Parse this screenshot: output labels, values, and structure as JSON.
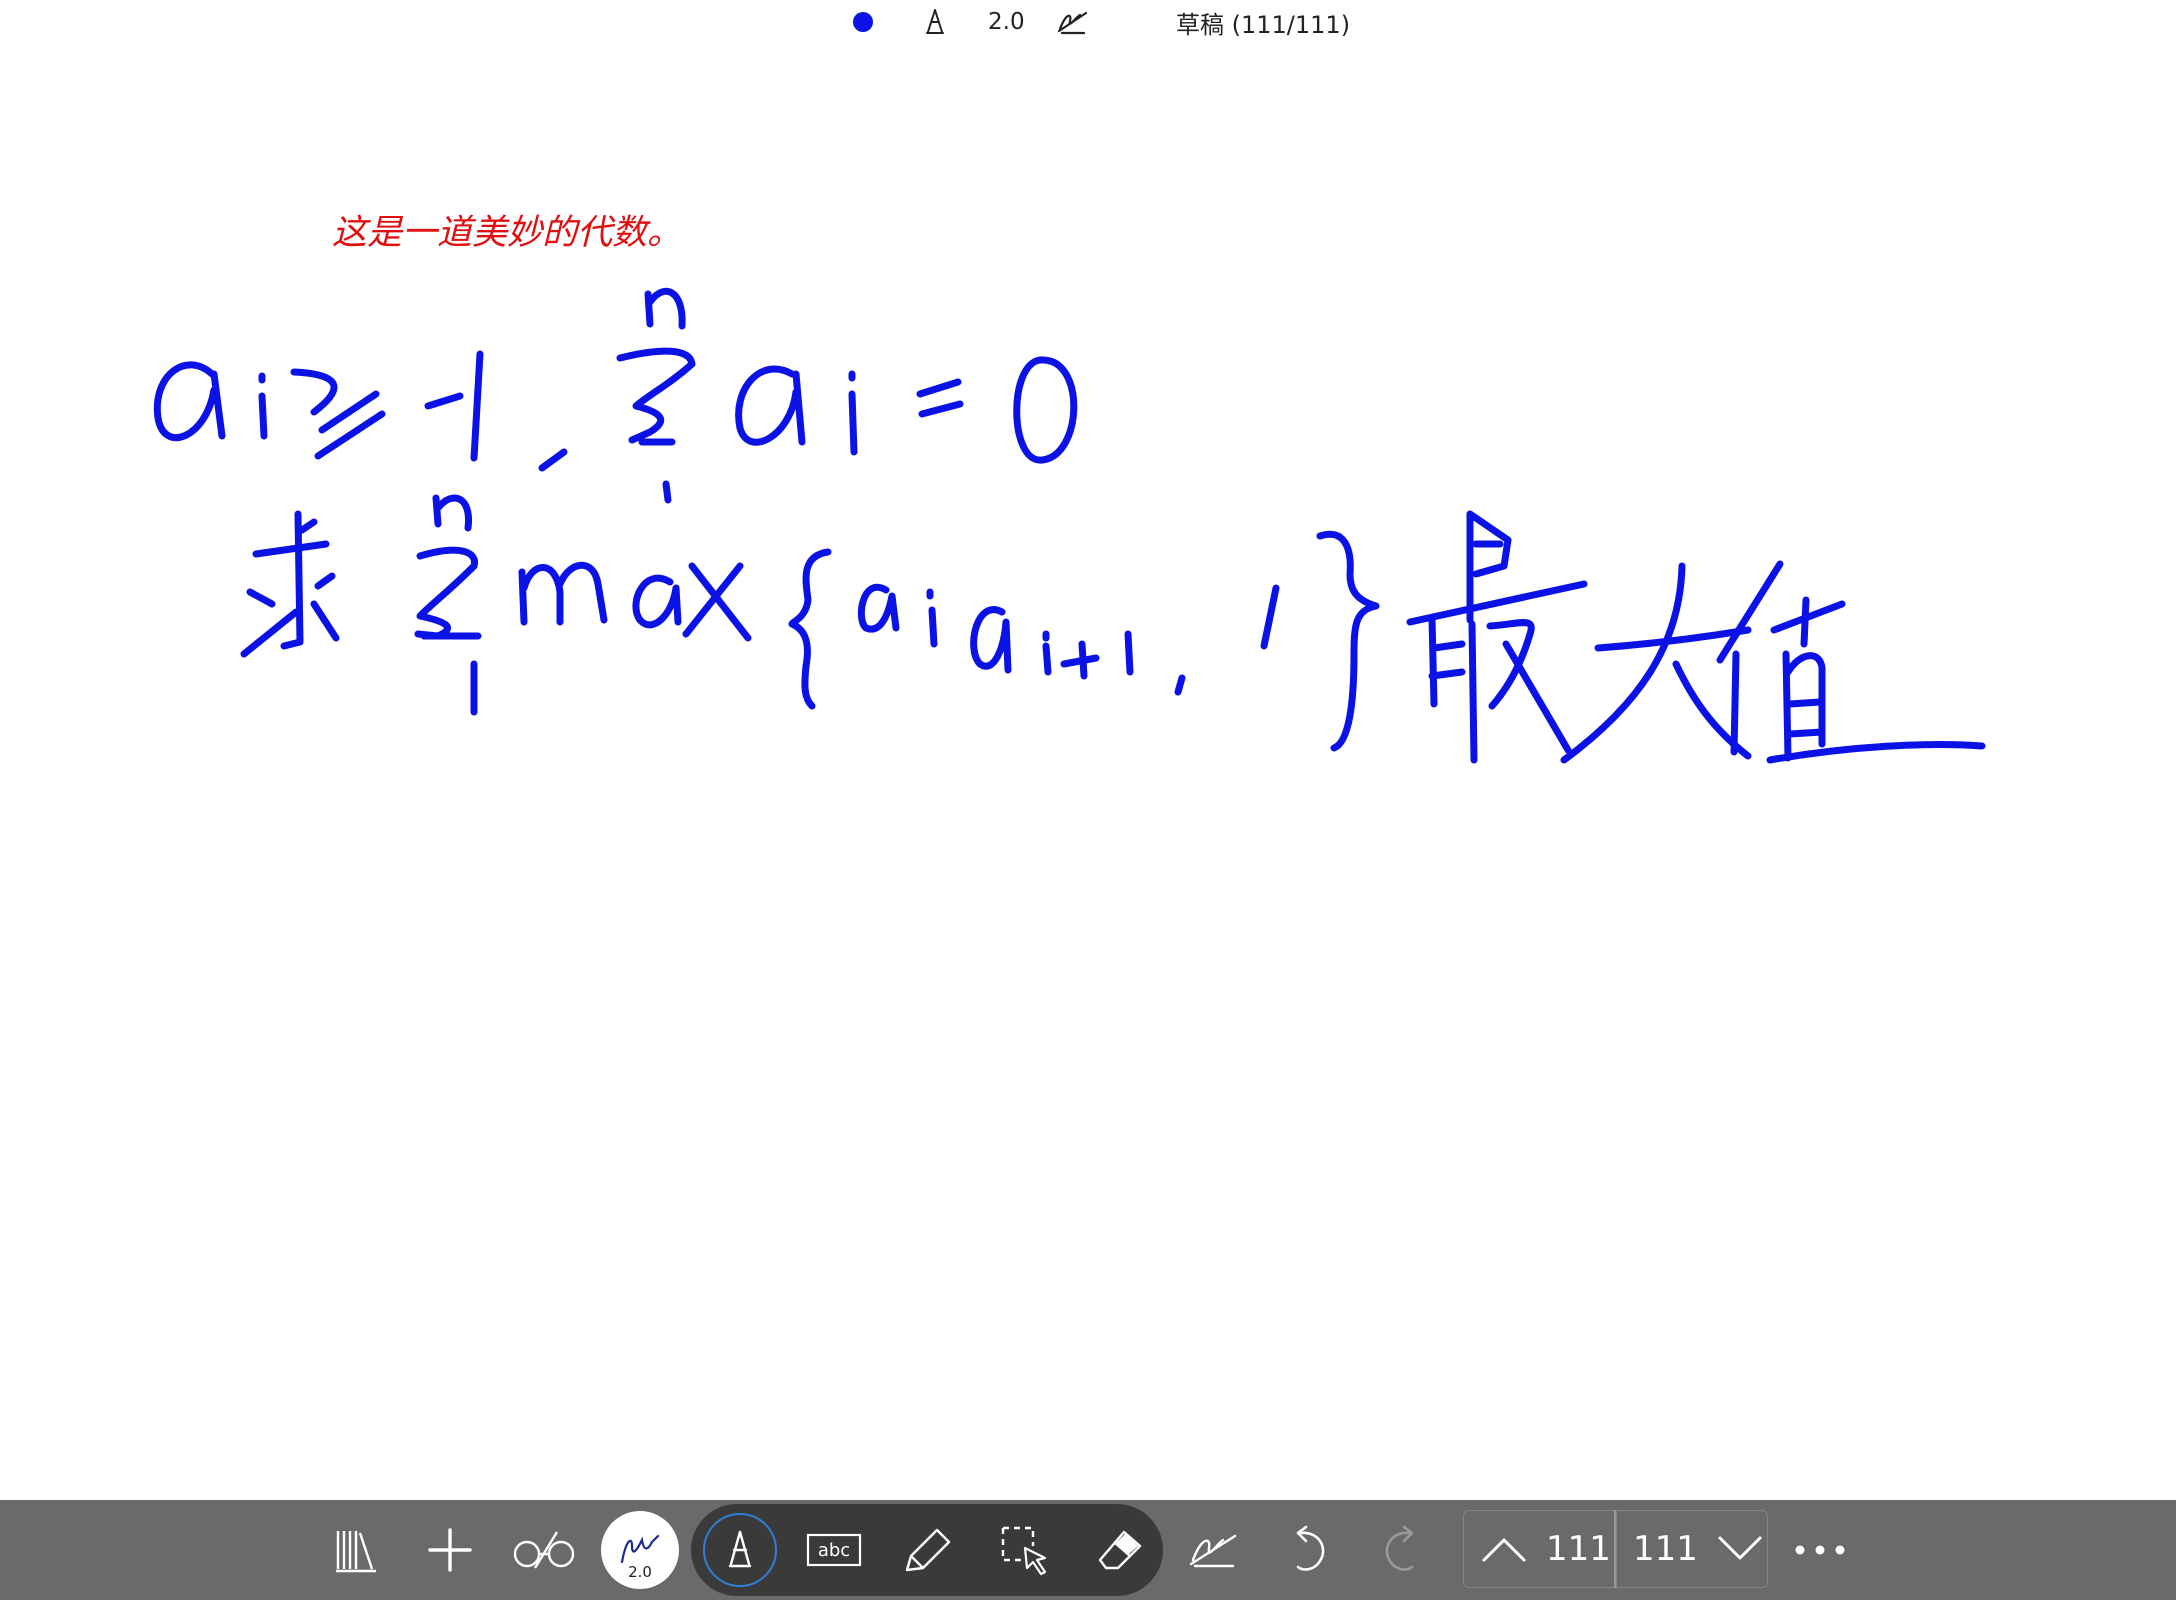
{
  "colors": {
    "ink": "#0a12e6",
    "note_text": "#e01010",
    "toolbar_bg": "#6a6a6a",
    "mode_pill_bg": "#3a3a3a",
    "active_ring": "#2f7fd9"
  },
  "status_bar": {
    "pen_color_icon": "filled-dot-icon",
    "pen_tip_icon": "pen-tip-icon",
    "pen_width": "2.0",
    "handwriting_off_icon": "hand-off-icon",
    "title": "草稿 (111/111)"
  },
  "canvas": {
    "note_text": "这是一道美妙的代数。",
    "handwriting": {
      "line1": [
        "a",
        "i",
        "≥",
        "-1",
        ",",
        "Σ",
        "n",
        "1",
        "a",
        "i",
        "=",
        "0"
      ],
      "line2": [
        "求",
        "Σ",
        "n",
        "1",
        "max",
        "{",
        "a",
        "i",
        "a",
        "i+1",
        ",",
        "1",
        "}",
        "最",
        "大",
        "值"
      ]
    }
  },
  "toolbar": {
    "notebooks_icon": "notebooks-icon",
    "add_page_icon": "plus-icon",
    "view_mode_icon": "glasses-icon",
    "pen_style": {
      "icon": "signature-icon",
      "label": "2.0"
    },
    "pen_tool_icon": "pen-tip-icon",
    "text_tool": {
      "icon": "text-box-icon",
      "label": "abc"
    },
    "highlighter_icon": "highlighter-icon",
    "lasso_icon": "lasso-select-icon",
    "eraser_icon": "eraser-icon",
    "hand_off_icon": "hand-off-icon",
    "undo_icon": "undo-icon",
    "redo_icon": "redo-icon",
    "prev_page": {
      "icon": "chevron-up-icon",
      "page": "111"
    },
    "next_page": {
      "icon": "chevron-down-icon",
      "page": "111"
    },
    "more_icon": "more-icon"
  }
}
